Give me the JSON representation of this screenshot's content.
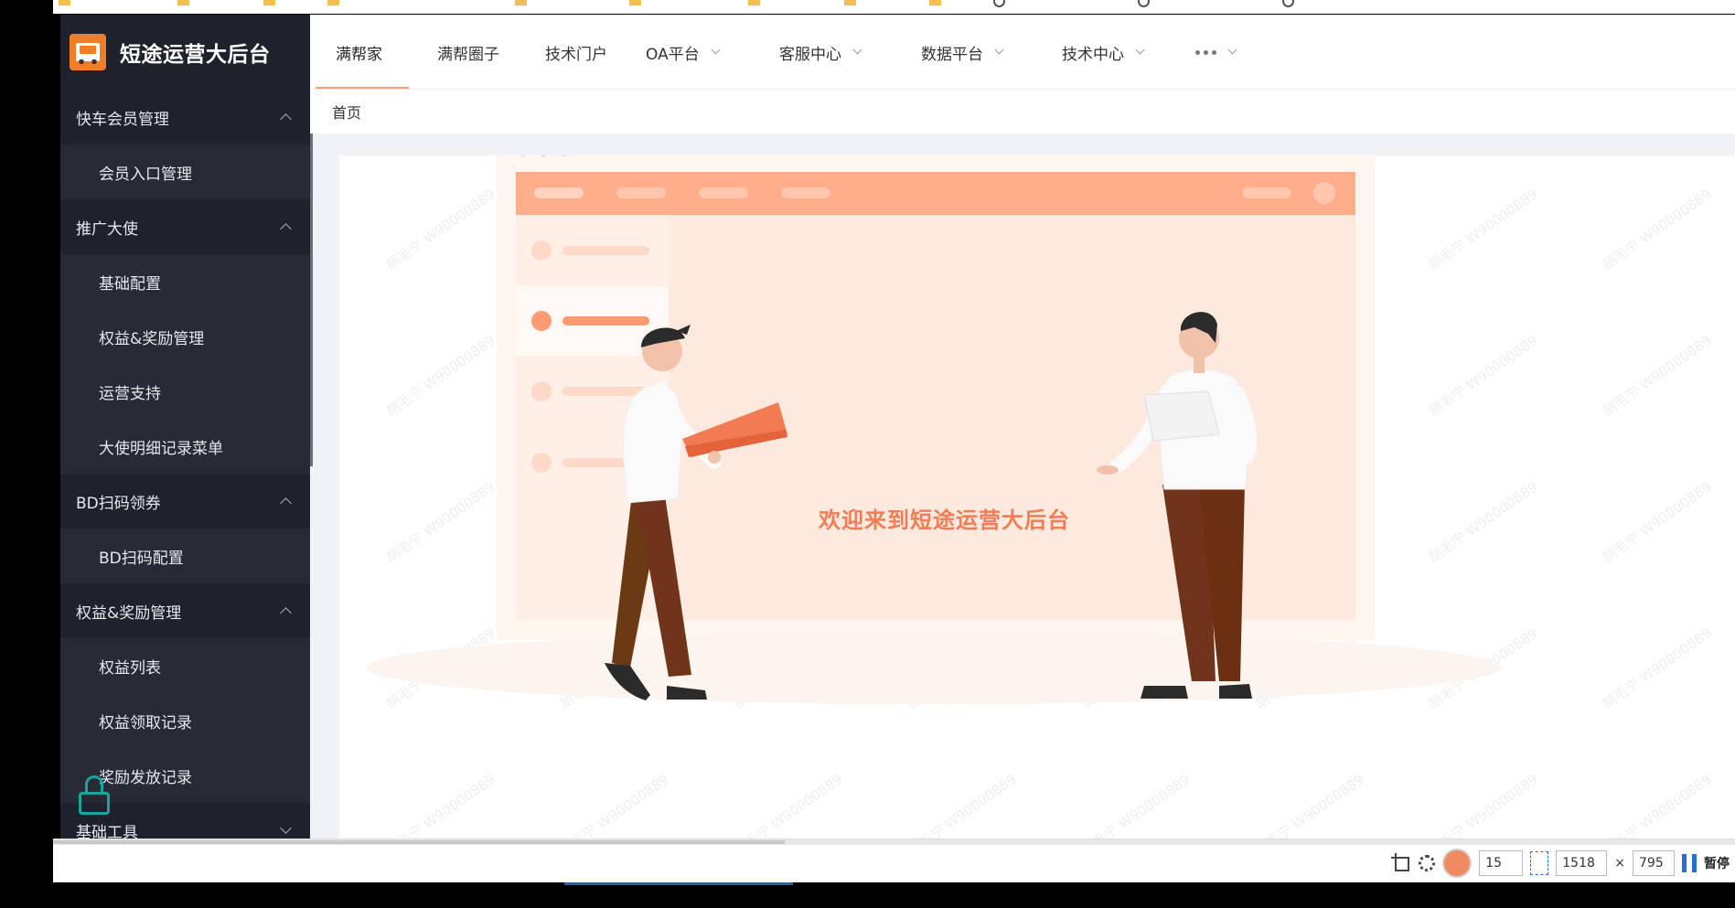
{
  "app": {
    "title": "短途运营大后台"
  },
  "sidebar": {
    "groups": [
      {
        "label": "快车会员管理",
        "expanded": true,
        "items": [
          "会员入口管理"
        ]
      },
      {
        "label": "推广大使",
        "expanded": true,
        "items": [
          "基础配置",
          "权益&奖励管理",
          "运营支持",
          "大使明细记录菜单"
        ]
      },
      {
        "label": "BD扫码领券",
        "expanded": true,
        "items": [
          "BD扫码配置"
        ]
      },
      {
        "label": "权益&奖励管理",
        "expanded": true,
        "items": [
          "权益列表",
          "权益领取记录",
          "奖励发放记录"
        ]
      },
      {
        "label": "基础工具",
        "expanded": false,
        "items": []
      }
    ]
  },
  "topnav": {
    "items": [
      {
        "label": "满帮家",
        "active": true,
        "dropdown": false
      },
      {
        "label": "满帮圈子",
        "active": false,
        "dropdown": false
      },
      {
        "label": "技术门户",
        "active": false,
        "dropdown": false
      },
      {
        "label": "OA平台",
        "active": false,
        "dropdown": true
      },
      {
        "label": "客服中心",
        "active": false,
        "dropdown": true
      },
      {
        "label": "数据平台",
        "active": false,
        "dropdown": true
      },
      {
        "label": "技术中心",
        "active": false,
        "dropdown": true
      },
      {
        "label": "",
        "active": false,
        "dropdown": true,
        "more": true
      }
    ]
  },
  "breadcrumb": {
    "home": "首页"
  },
  "welcome": {
    "text": "欢迎来到短途运营大后台"
  },
  "watermark": {
    "text": "胡毛宁 W90000889"
  },
  "capture_toolbar": {
    "interval": "15",
    "width": "1518",
    "times": "×",
    "height": "795",
    "pause_label": "暂停"
  },
  "colors": {
    "accent": "#f07d56",
    "sidebar_bg": "#1e222d",
    "sidebar_item_bg": "#272b36",
    "lock_icon": "#1aa4a4"
  }
}
